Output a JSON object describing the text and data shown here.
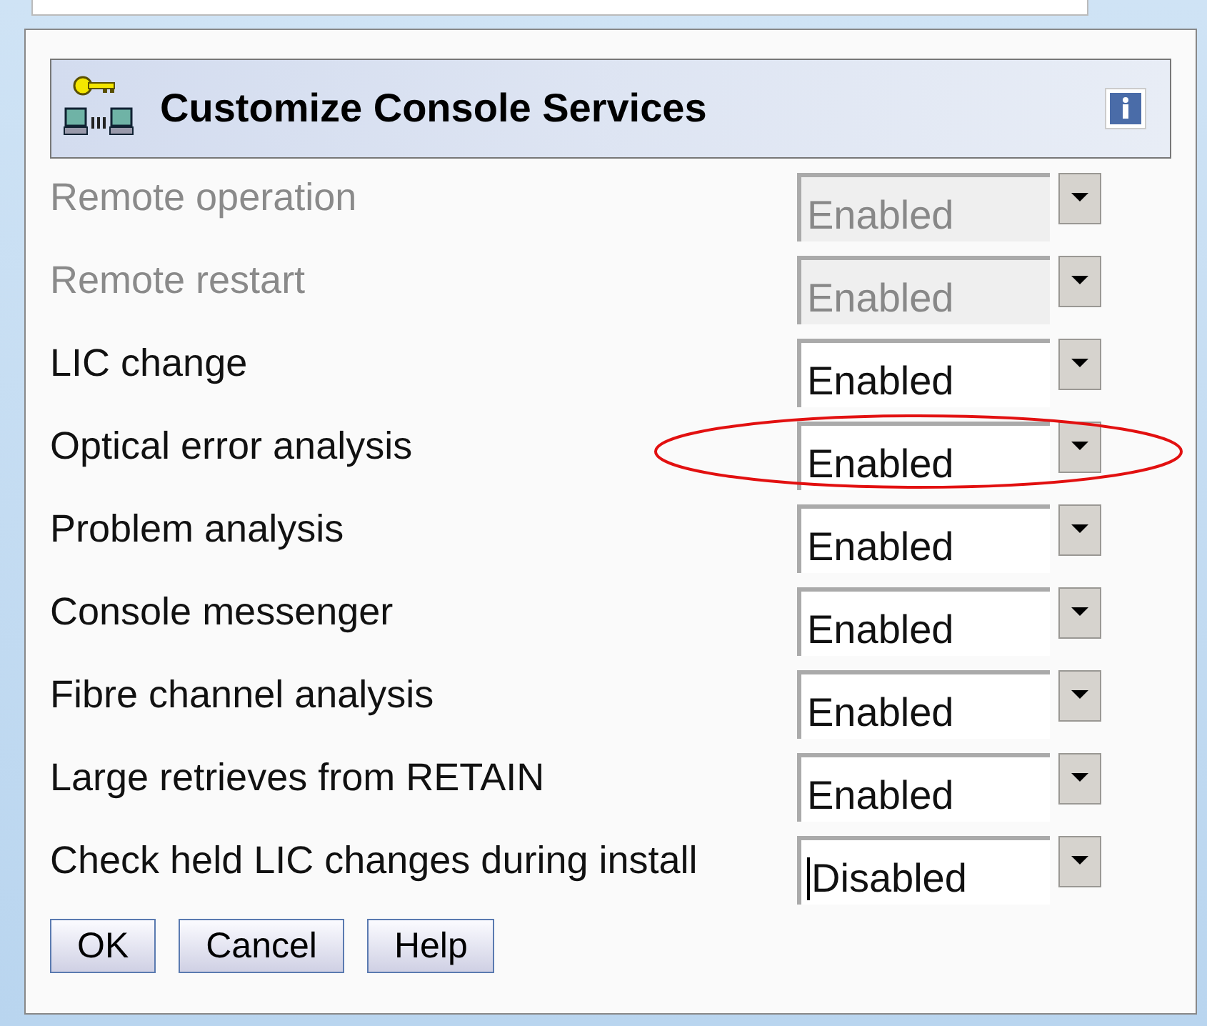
{
  "dialog": {
    "title": "Customize Console Services"
  },
  "settings": [
    {
      "label": "Remote operation",
      "value": "Enabled",
      "disabled": true,
      "circled": false,
      "caret": false
    },
    {
      "label": "Remote restart",
      "value": "Enabled",
      "disabled": true,
      "circled": false,
      "caret": false
    },
    {
      "label": "LIC change",
      "value": "Enabled",
      "disabled": false,
      "circled": false,
      "caret": false
    },
    {
      "label": "Optical error analysis",
      "value": "Enabled",
      "disabled": false,
      "circled": true,
      "caret": false
    },
    {
      "label": "Problem analysis",
      "value": "Enabled",
      "disabled": false,
      "circled": false,
      "caret": false
    },
    {
      "label": "Console messenger",
      "value": "Enabled",
      "disabled": false,
      "circled": false,
      "caret": false
    },
    {
      "label": "Fibre channel analysis",
      "value": "Enabled",
      "disabled": false,
      "circled": false,
      "caret": false
    },
    {
      "label": "Large retrieves from RETAIN",
      "value": "Enabled",
      "disabled": false,
      "circled": false,
      "caret": false
    },
    {
      "label": "Check held LIC changes during install",
      "value": "Disabled",
      "disabled": false,
      "circled": false,
      "caret": true
    }
  ],
  "buttons": [
    "OK",
    "Cancel",
    "Help"
  ]
}
